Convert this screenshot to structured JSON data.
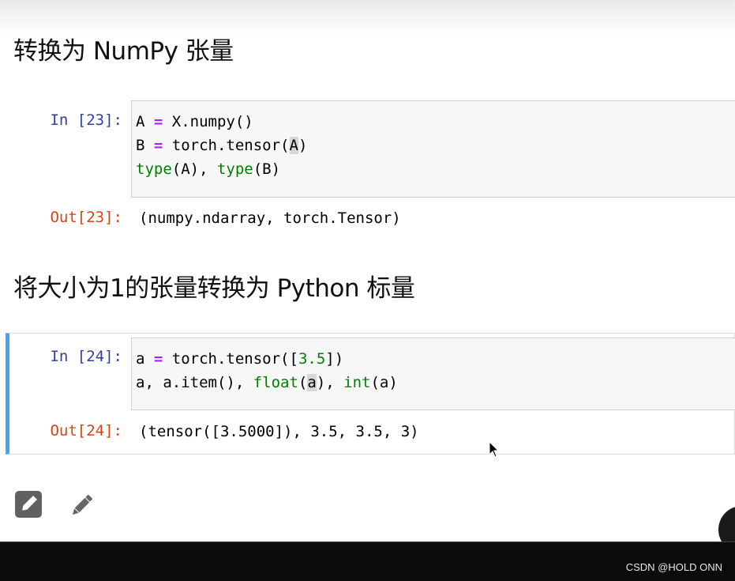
{
  "sections": {
    "heading1": "转换为 NumPy 张量",
    "heading2": "将大小为1的张量转换为 Python 标量"
  },
  "cells": {
    "cell23": {
      "in_prompt": "In [23]:",
      "out_prompt": "Out[23]:",
      "output": "(numpy.ndarray, torch.Tensor)"
    },
    "cell24": {
      "in_prompt": "In [24]:",
      "out_prompt": "Out[24]:",
      "output": "(tensor([3.5000]), 3.5, 3.5, 3)"
    }
  },
  "toolbar": {
    "edit_icon_name": "pencil-square-icon",
    "pen_icon_name": "pencil-icon"
  },
  "colors": {
    "accent": "#42a5f5",
    "in_prompt": "#303f9f",
    "out_prompt": "#d84315",
    "keyword": "#aa22ff",
    "builtin": "#008000"
  },
  "watermark": "CSDN @HOLD ONN"
}
